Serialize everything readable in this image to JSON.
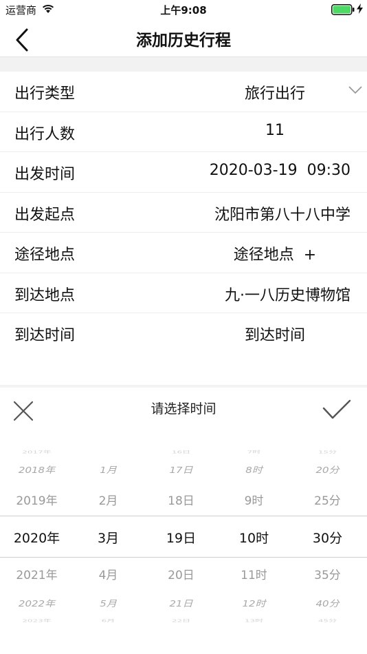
{
  "status_bar": {
    "carrier": "运营商",
    "time": "上午9:08",
    "icons": [
      "wifi-icon",
      "battery-icon",
      "charging-bolt-icon"
    ]
  },
  "nav": {
    "title": "添加历史行程",
    "back_icon": "chevron-left-icon"
  },
  "form": {
    "rows": [
      {
        "label": "出行类型",
        "value": "旅行出行",
        "icon": "chevron-down-icon"
      },
      {
        "label": "出行人数",
        "value": "11"
      },
      {
        "label": "出发时间",
        "value": "2020-03-19  09:30"
      },
      {
        "label": "出发起点",
        "value": "沈阳市第八十八中学"
      },
      {
        "label": "途径地点",
        "value": "途径地点  +"
      },
      {
        "label": "到达地点",
        "value": "九·一八历史博物馆"
      },
      {
        "label": "到达时间",
        "value": "到达时间"
      }
    ]
  },
  "picker": {
    "title": "请选择时间",
    "close_icon": "close-icon",
    "confirm_icon": "checkmark-icon",
    "columns": [
      {
        "name": "year",
        "items": [
          "2017年",
          "2018年",
          "2019年",
          "2020年",
          "2021年",
          "2022年",
          "2023年"
        ],
        "selected": "2020年"
      },
      {
        "name": "month",
        "items": [
          "",
          "1月",
          "2月",
          "3月",
          "4月",
          "5月",
          "6月"
        ],
        "selected": "3月"
      },
      {
        "name": "day",
        "items": [
          "16日",
          "17日",
          "18日",
          "19日",
          "20日",
          "21日",
          "22日"
        ],
        "selected": "19日"
      },
      {
        "name": "hour",
        "items": [
          "7时",
          "8时",
          "9时",
          "10时",
          "11时",
          "12时",
          "13时"
        ],
        "selected": "10时"
      },
      {
        "name": "minute",
        "items": [
          "15分",
          "20分",
          "25分",
          "30分",
          "35分",
          "40分",
          "45分"
        ],
        "selected": "30分"
      }
    ]
  }
}
